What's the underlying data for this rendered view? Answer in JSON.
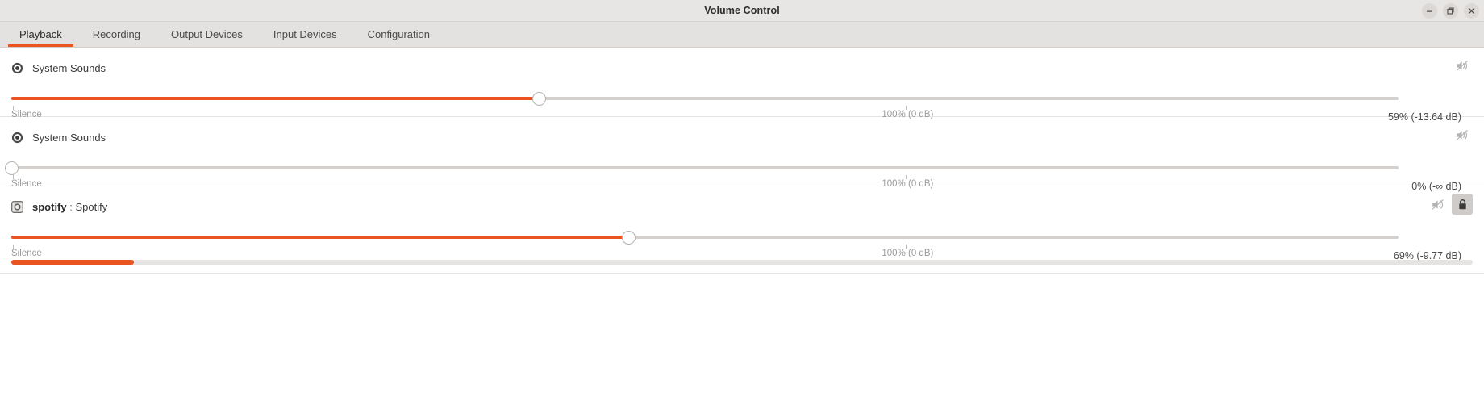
{
  "window": {
    "title": "Volume Control",
    "controls": [
      {
        "name": "minimize-button",
        "glyph": "minimize"
      },
      {
        "name": "maximize-button",
        "glyph": "maximize"
      },
      {
        "name": "close-button",
        "glyph": "close"
      }
    ]
  },
  "tabs": [
    {
      "label": "Playback",
      "active": true
    },
    {
      "label": "Recording",
      "active": false
    },
    {
      "label": "Output Devices",
      "active": false
    },
    {
      "label": "Input Devices",
      "active": false
    },
    {
      "label": "Configuration",
      "active": false
    }
  ],
  "accent_color": "#e95420",
  "labels": {
    "silence": "Silence",
    "base": "100% (0 dB)"
  },
  "streams": [
    {
      "icon": "system-sounds-icon",
      "name_bold": "",
      "name_sep": "",
      "name_rest": "System Sounds",
      "volume_percent": 59,
      "value_text": "59% (-13.64 dB)",
      "mute_icon": "speaker-muted-icon",
      "lock_button": false,
      "lock_pressed": false,
      "peak_meter": false,
      "peak_percent": 0
    },
    {
      "icon": "system-sounds-icon",
      "name_bold": "",
      "name_sep": "",
      "name_rest": "System Sounds",
      "volume_percent": 0,
      "value_text": "0% (-∞ dB)",
      "mute_icon": "speaker-muted-icon",
      "lock_button": false,
      "lock_pressed": false,
      "peak_meter": false,
      "peak_percent": 0
    },
    {
      "icon": "spotify-app-icon",
      "name_bold": "spotify",
      "name_sep": " : ",
      "name_rest": "Spotify",
      "volume_percent": 69,
      "value_text": "69% (-9.77 dB)",
      "mute_icon": "speaker-muted-icon",
      "lock_button": true,
      "lock_pressed": true,
      "peak_meter": true,
      "peak_percent": 8.4
    }
  ]
}
